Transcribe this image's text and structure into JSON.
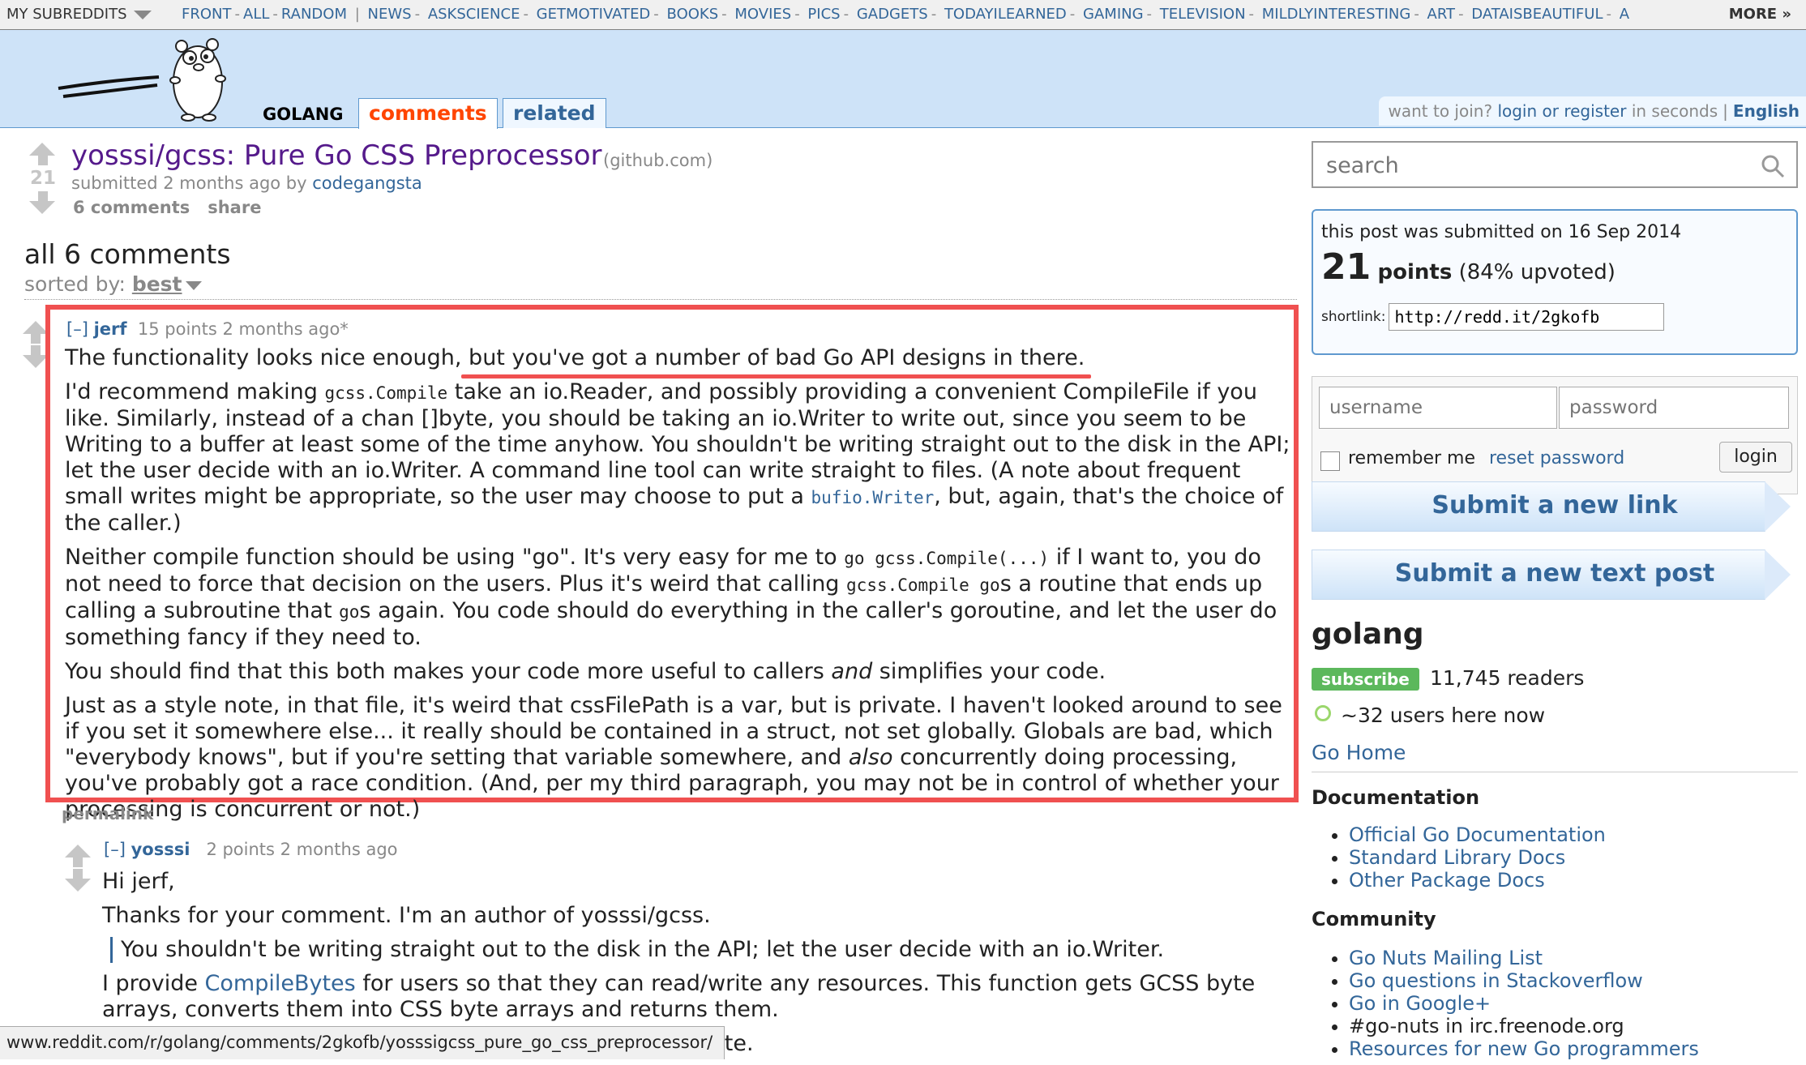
{
  "topbar": {
    "my_subreddits": "MY SUBREDDITS",
    "front": "FRONT",
    "all": "ALL",
    "random": "RANDOM",
    "subreddits": [
      "NEWS",
      "ASKSCIENCE",
      "GETMOTIVATED",
      "BOOKS",
      "MOVIES",
      "PICS",
      "GADGETS",
      "TODAYILEARNED",
      "GAMING",
      "TELEVISION",
      "MILDLYINTERESTING",
      "ART",
      "DATAISBEAUTIFUL",
      "A"
    ],
    "more": "MORE »"
  },
  "header": {
    "subreddit_name": "GOLANG",
    "tab_comments": "comments",
    "tab_related": "related",
    "join_text": "want to join?",
    "login_register": "login or register",
    "in_seconds": "in seconds",
    "language": "English"
  },
  "post": {
    "score": "21",
    "title": "yosssi/gcss: Pure Go CSS Preprocessor",
    "domain": "(github.com)",
    "submitted": "submitted 2 months ago by",
    "author": "codegangsta",
    "comments_link": "6 comments",
    "share": "share"
  },
  "comments_area": {
    "heading": "all 6 comments",
    "sorted_by": "sorted by:",
    "sort_value": "best"
  },
  "comment1": {
    "collapse": "[–]",
    "author": "jerf",
    "meta": "15 points 2 months ago*",
    "p1_a": "The functionality looks nice enough,",
    "p1_b": " but you've got a number of bad Go API designs in there.",
    "p2_a": "I'd recommend making ",
    "p2_code": "gcss.Compile",
    "p2_b": " take an io.Reader, and possibly providing a convenient CompileFile if you like. Similarly, instead of a chan []byte, you should be taking an io.Writer to write out, since you seem to be Writing to a buffer at least some of the time anyhow. You shouldn't be writing straight out to the disk in the API; let the user decide with an io.Writer. A command line tool can write straight to files. (A note about frequent small writes might be appropriate, so the user may choose to put a ",
    "p2_link": "bufio.Writer",
    "p2_c": ", but, again, that's the choice of the caller.)",
    "p3_a": "Neither compile function should be using \"go\". It's very easy for me to ",
    "p3_code1": "go gcss.Compile(...)",
    "p3_b": " if I want to, you do not need to force that decision on the users. Plus it's weird that calling ",
    "p3_code2": "gcss.Compile go",
    "p3_c": "s a routine that ends up calling a subroutine that ",
    "p3_code3": "go",
    "p3_d": "s again. You code should do everything in the caller's goroutine, and let the user do something fancy if they need to.",
    "p4_a": "You should find that this both makes your code more useful to callers ",
    "p4_em": "and",
    "p4_b": " simplifies your code.",
    "p5_a": "Just as a style note, in that file, it's weird that cssFilePath is a var, but is private. I haven't looked around to see if you set it somewhere else... it really should be contained in a struct, not set globally. Globals are bad, which \"everybody knows\", but if you're setting that variable somewhere, and ",
    "p5_em": "also",
    "p5_b": " concurrently doing processing, you've probably got a race condition. (And, per my third paragraph, you may not be in control of whether your processing is concurrent or not.)",
    "permalink": "permalink"
  },
  "comment2": {
    "collapse": "[–]",
    "author": "yosssi",
    "meta": "2 points 2 months ago",
    "p1": "Hi jerf,",
    "p2": "Thanks for your comment. I'm an author of yosssi/gcss.",
    "quote": "You shouldn't be writing straight out to the disk in the API; let the user decide with an io.Writer.",
    "p3_a": "I provide ",
    "p3_link": "CompileBytes",
    "p3_b": " for users so that they can read/write any resources. This function gets GCSS byte arrays, converts them into CSS byte arrays and returns them.",
    "p4_partial": "a var, but is private."
  },
  "statusbar": {
    "url": "www.reddit.com/r/golang/comments/2gkofb/yosssigcss_pure_go_css_preprocessor/"
  },
  "sidebar": {
    "search_placeholder": "search",
    "submitted_on": "this post was submitted on 16 Sep 2014",
    "points": "21",
    "points_word": "points",
    "upvoted": "(84% upvoted)",
    "shortlink_label": "shortlink:",
    "shortlink": "http://redd.it/2gkofb",
    "username_placeholder": "username",
    "password_placeholder": "password",
    "remember_me": "remember me",
    "reset_password": "reset password",
    "login": "login",
    "submit_link": "Submit a new link",
    "submit_text": "Submit a new text post",
    "subreddit_title": "golang",
    "subscribe": "subscribe",
    "readers": "11,745 readers",
    "online": "~32 users here now",
    "go_home": "Go Home",
    "documentation_heading": "Documentation",
    "documentation_links": [
      "Official Go Documentation",
      "Standard Library Docs",
      "Other Package Docs"
    ],
    "community_heading": "Community",
    "community_links": [
      "Go Nuts Mailing List",
      "Go questions in Stackoverflow",
      "Go in Google+",
      "#go-nuts in irc.freenode.org",
      "Resources for new Go programmers"
    ]
  },
  "colors": {
    "highlight_box": "#f05050",
    "link": "#336699",
    "header_bg": "#cee3f8",
    "comments_tab": "#ff4500",
    "subscribe": "#5cb85c"
  }
}
